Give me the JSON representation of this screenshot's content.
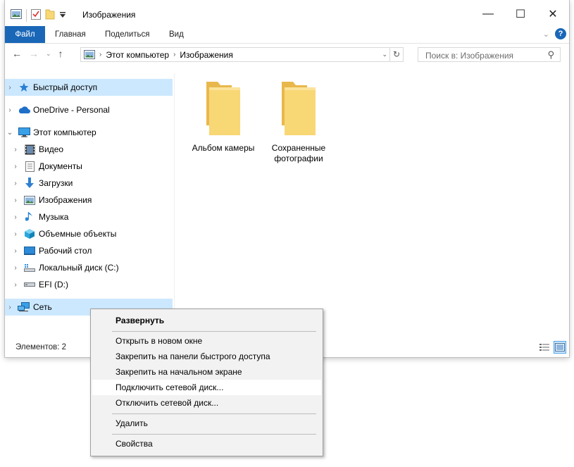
{
  "window": {
    "title": "Изображения",
    "controls": {
      "minimize": "—",
      "maximize": "☐",
      "close": "✕"
    }
  },
  "ribbon": {
    "tabs": [
      "Файл",
      "Главная",
      "Поделиться",
      "Вид"
    ],
    "help": "?"
  },
  "address": {
    "crumbs": [
      "Этот компьютер",
      "Изображения"
    ]
  },
  "search": {
    "placeholder": "Поиск в: Изображения"
  },
  "navpane": {
    "items": [
      {
        "label": "Быстрый доступ",
        "icon": "star-icon"
      },
      {
        "label": "OneDrive - Personal",
        "icon": "cloud-icon"
      },
      {
        "label": "Этот компьютер",
        "icon": "computer-icon"
      },
      {
        "label": "Видео",
        "icon": "video-icon"
      },
      {
        "label": "Документы",
        "icon": "documents-icon"
      },
      {
        "label": "Загрузки",
        "icon": "downloads-icon"
      },
      {
        "label": "Изображения",
        "icon": "pictures-icon"
      },
      {
        "label": "Музыка",
        "icon": "music-icon"
      },
      {
        "label": "Объемные объекты",
        "icon": "3d-objects-icon"
      },
      {
        "label": "Рабочий стол",
        "icon": "desktop-icon"
      },
      {
        "label": "Локальный диск (C:)",
        "icon": "local-disk-icon"
      },
      {
        "label": "EFI (D:)",
        "icon": "drive-icon"
      },
      {
        "label": "Сеть",
        "icon": "network-icon"
      }
    ]
  },
  "content": {
    "folders": [
      {
        "label": "Альбом камеры"
      },
      {
        "label": "Сохраненные фотографии"
      }
    ]
  },
  "status": {
    "items": "Элементов: 2"
  },
  "context_menu": {
    "items": [
      "Развернуть",
      "Открыть в новом окне",
      "Закрепить на панели быстрого доступа",
      "Закрепить на начальном экране",
      "Подключить сетевой диск...",
      "Отключить сетевой диск...",
      "Удалить",
      "Свойства"
    ]
  },
  "colors": {
    "accent": "#1a67b8",
    "selection": "#cce8ff",
    "folder": "#f8d775"
  }
}
